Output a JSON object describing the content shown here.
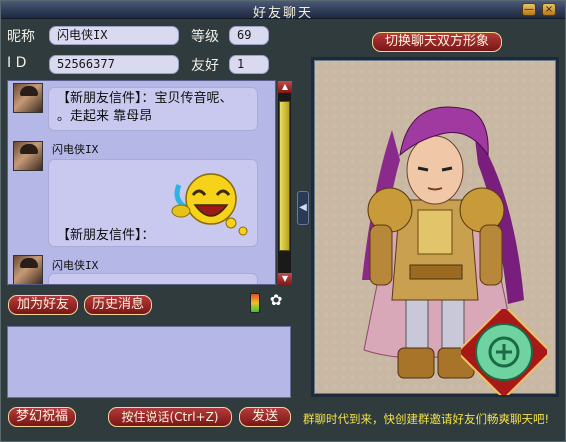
{
  "window": {
    "title": "好友聊天",
    "min_label": "—",
    "close_label": "×"
  },
  "profile": {
    "nickname_label": "昵称",
    "nickname_value": "闪电侠IX",
    "level_label": "等级",
    "level_value": "69",
    "id_label": "I D",
    "id_value": "52566377",
    "friendship_label": "友好",
    "friendship_value": "1"
  },
  "chat": {
    "messages": [
      {
        "text_line1": "【新朋友信件】：宝贝传音呢、",
        "text_line2": "。走起来  靠母昂"
      },
      {
        "sender": "闪电侠IX",
        "text_line1": "【新朋友信件】："
      },
      {
        "sender": "闪电侠IX"
      }
    ],
    "scroll_up": "▲",
    "scroll_down": "▼"
  },
  "buttons": {
    "add_friend": "加为好友",
    "history": "历史消息",
    "blessing": "梦幻祝福",
    "voice": "按住说话(Ctrl+Z)",
    "send": "发送",
    "switch_view": "切换聊天双方形象"
  },
  "icons": {
    "signal": "signal-icon",
    "paw": "paw-icon",
    "laugh_emoji": "laughing-emoji-icon",
    "emblem": "jade-emblem-icon"
  },
  "marquee": "群聊时代到来，快创建群邀请好友们畅爽聊天吧!",
  "colors": {
    "accent_red": "#8a1e1e",
    "chat_bg": "#b5b7e6",
    "portrait_bg": "#c8b7a3",
    "marquee": "#f2e24a"
  }
}
